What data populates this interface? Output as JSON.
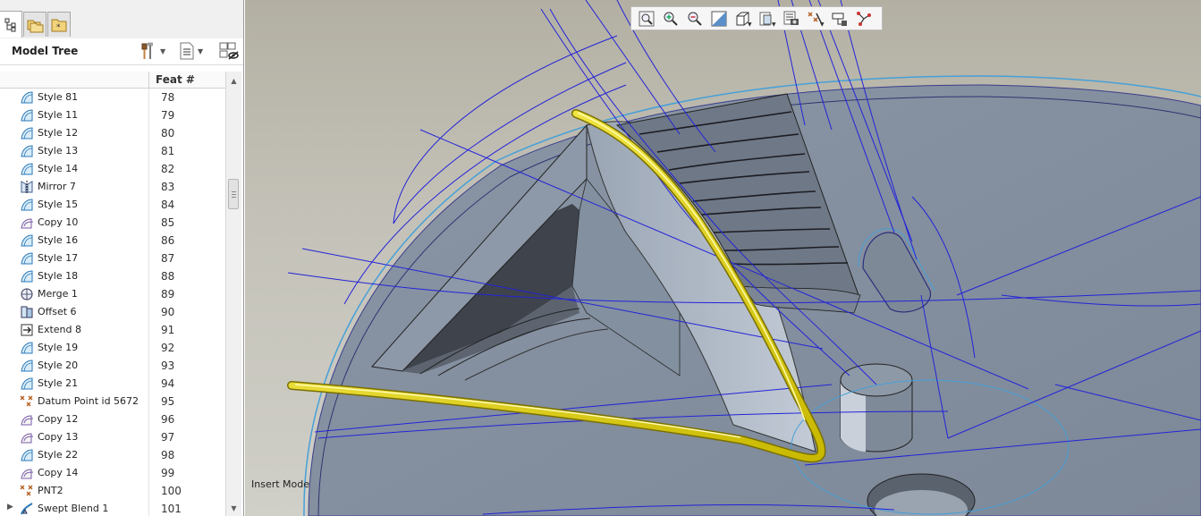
{
  "model_tree": {
    "title": "Model Tree",
    "column_feat": "Feat #",
    "rows": [
      {
        "name": "Style 81",
        "feat": "78",
        "icon": "style-surface-icon"
      },
      {
        "name": "Style 11",
        "feat": "79",
        "icon": "style-surface-icon"
      },
      {
        "name": "Style 12",
        "feat": "80",
        "icon": "style-surface-icon"
      },
      {
        "name": "Style 13",
        "feat": "81",
        "icon": "style-surface-icon"
      },
      {
        "name": "Style 14",
        "feat": "82",
        "icon": "style-surface-icon"
      },
      {
        "name": "Mirror 7",
        "feat": "83",
        "icon": "mirror-icon"
      },
      {
        "name": "Style 15",
        "feat": "84",
        "icon": "style-surface-icon"
      },
      {
        "name": "Copy 10",
        "feat": "85",
        "icon": "copy-surface-icon"
      },
      {
        "name": "Style 16",
        "feat": "86",
        "icon": "style-surface-icon"
      },
      {
        "name": "Style 17",
        "feat": "87",
        "icon": "style-surface-icon"
      },
      {
        "name": "Style 18",
        "feat": "88",
        "icon": "style-surface-icon"
      },
      {
        "name": "Merge 1",
        "feat": "89",
        "icon": "merge-icon"
      },
      {
        "name": "Offset 6",
        "feat": "90",
        "icon": "offset-icon"
      },
      {
        "name": "Extend 8",
        "feat": "91",
        "icon": "extend-icon"
      },
      {
        "name": "Style 19",
        "feat": "92",
        "icon": "style-surface-icon"
      },
      {
        "name": "Style 20",
        "feat": "93",
        "icon": "style-surface-icon"
      },
      {
        "name": "Style 21",
        "feat": "94",
        "icon": "style-surface-icon"
      },
      {
        "name": "Datum Point id 5672",
        "feat": "95",
        "icon": "datum-point-icon"
      },
      {
        "name": "Copy 12",
        "feat": "96",
        "icon": "copy-surface-icon"
      },
      {
        "name": "Copy 13",
        "feat": "97",
        "icon": "copy-surface-icon"
      },
      {
        "name": "Style 22",
        "feat": "98",
        "icon": "style-surface-icon"
      },
      {
        "name": "Copy 14",
        "feat": "99",
        "icon": "copy-surface-icon"
      },
      {
        "name": "PNT2",
        "feat": "100",
        "icon": "datum-point-icon"
      },
      {
        "name": "Swept Blend 1",
        "feat": "101",
        "icon": "swept-blend-icon",
        "expandable": true
      }
    ]
  },
  "panel_tabs": [
    {
      "icon": "model-tree-tab-icon",
      "active": true
    },
    {
      "icon": "folder-browser-tab-icon",
      "active": false
    },
    {
      "icon": "favorites-tab-icon",
      "active": false
    }
  ],
  "header_tools": [
    {
      "icon": "settings-hammer-icon"
    },
    {
      "icon": "show-list-icon"
    },
    {
      "icon": "tree-filter-icon"
    }
  ],
  "view_toolbar": [
    {
      "icon": "zoom-refit-icon"
    },
    {
      "icon": "zoom-in-icon"
    },
    {
      "icon": "zoom-out-icon"
    },
    {
      "icon": "repaint-icon"
    },
    {
      "icon": "display-style-icon"
    },
    {
      "icon": "saved-orientations-icon"
    },
    {
      "icon": "view-manager-icon"
    },
    {
      "icon": "datum-display-icon"
    },
    {
      "icon": "annotation-display-icon"
    },
    {
      "icon": "spin-center-icon"
    }
  ],
  "status": {
    "mode": "Insert Mode"
  },
  "colors": {
    "curve_blue": "#2323d8",
    "highlight_yellow": "#f2e600",
    "surface_gray": "#8792a0",
    "background": "#c3c1b7"
  }
}
